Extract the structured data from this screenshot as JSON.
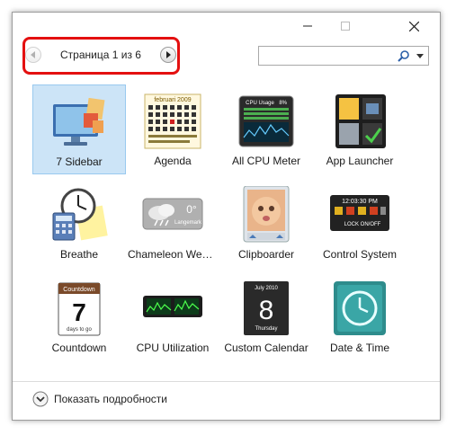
{
  "pager": {
    "text": "Страница 1 из 6",
    "prev_icon": "chevron-left-icon",
    "next_icon": "chevron-right-icon"
  },
  "search": {
    "value": "",
    "icon": "search-icon"
  },
  "gadgets": [
    {
      "label": "7 Sidebar",
      "icon": "sidebar-monitor-icon",
      "selected": true
    },
    {
      "label": "Agenda",
      "icon": "calendar-grid-icon",
      "selected": false
    },
    {
      "label": "All CPU Meter",
      "icon": "cpu-meter-icon",
      "selected": false
    },
    {
      "label": "App Launcher",
      "icon": "app-launcher-icon",
      "selected": false
    },
    {
      "label": "Breathe",
      "icon": "clock-calculator-icon",
      "selected": false
    },
    {
      "label": "Chameleon Weather",
      "icon": "weather-cloud-icon",
      "selected": false
    },
    {
      "label": "Clipboarder",
      "icon": "baby-photo-icon",
      "selected": false
    },
    {
      "label": "Control System",
      "icon": "control-system-icon",
      "selected": false
    },
    {
      "label": "Countdown",
      "icon": "countdown-calendar-icon",
      "selected": false
    },
    {
      "label": "CPU Utilization",
      "icon": "cpu-graph-icon",
      "selected": false
    },
    {
      "label": "Custom Calendar",
      "icon": "custom-calendar-icon",
      "selected": false
    },
    {
      "label": "Date & Time",
      "icon": "date-time-clock-icon",
      "selected": false
    }
  ],
  "icon_text": {
    "agenda_header": "februari 2009",
    "cpu_title": "CPU Usage",
    "cpu_pct": "8%",
    "weather_temp": "0°",
    "weather_city": "Langemark",
    "control_time": "12:03:30 PM",
    "control_lock": "LOCK ON/OFF",
    "countdown_title": "Countdown",
    "countdown_num": "7",
    "countdown_sub": "days to go",
    "custom_month": "July 2010",
    "custom_day": "8",
    "custom_weekday": "Thursday"
  },
  "footer": {
    "details_label": "Показать подробности",
    "details_icon": "chevron-down-circle-icon"
  }
}
